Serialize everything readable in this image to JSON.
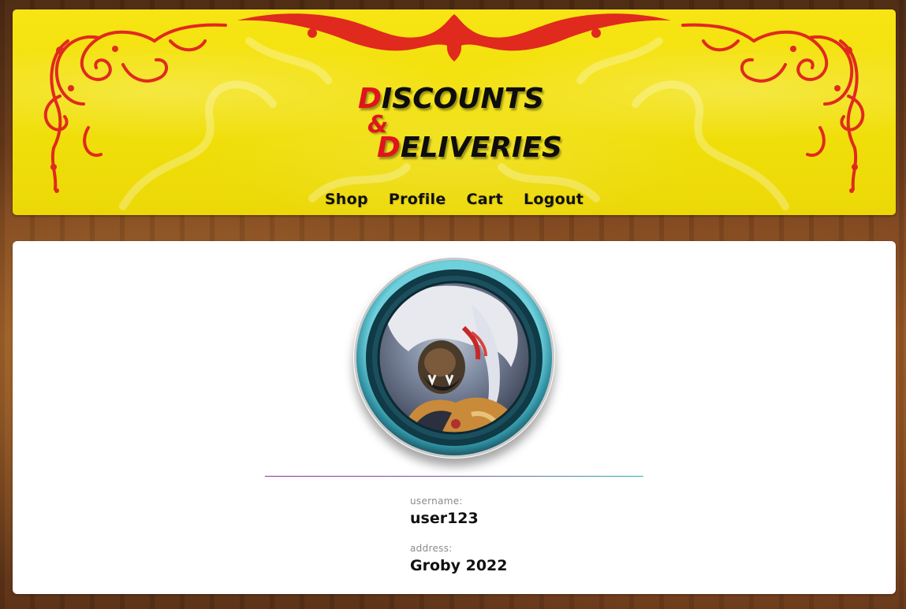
{
  "brand": {
    "line1_cap": "D",
    "line1_rest": "ISCOUNTS",
    "ampersand": "&",
    "line2_cap": "D",
    "line2_rest": "ELIVERIES"
  },
  "nav": {
    "items": [
      {
        "label": "Shop"
      },
      {
        "label": "Profile"
      },
      {
        "label": "Cart"
      },
      {
        "label": "Logout"
      }
    ]
  },
  "profile": {
    "avatar_icon": "character-portrait-icon",
    "fields": [
      {
        "label": "username:",
        "value": "user123"
      },
      {
        "label": "address:",
        "value": "Groby 2022"
      }
    ]
  },
  "colors": {
    "header_bg": "#f0df0a",
    "ornament_red": "#e02a1e",
    "brand_red": "#e0141f",
    "divider_start": "#9b2aa3",
    "divider_end": "#2fb0b8"
  }
}
